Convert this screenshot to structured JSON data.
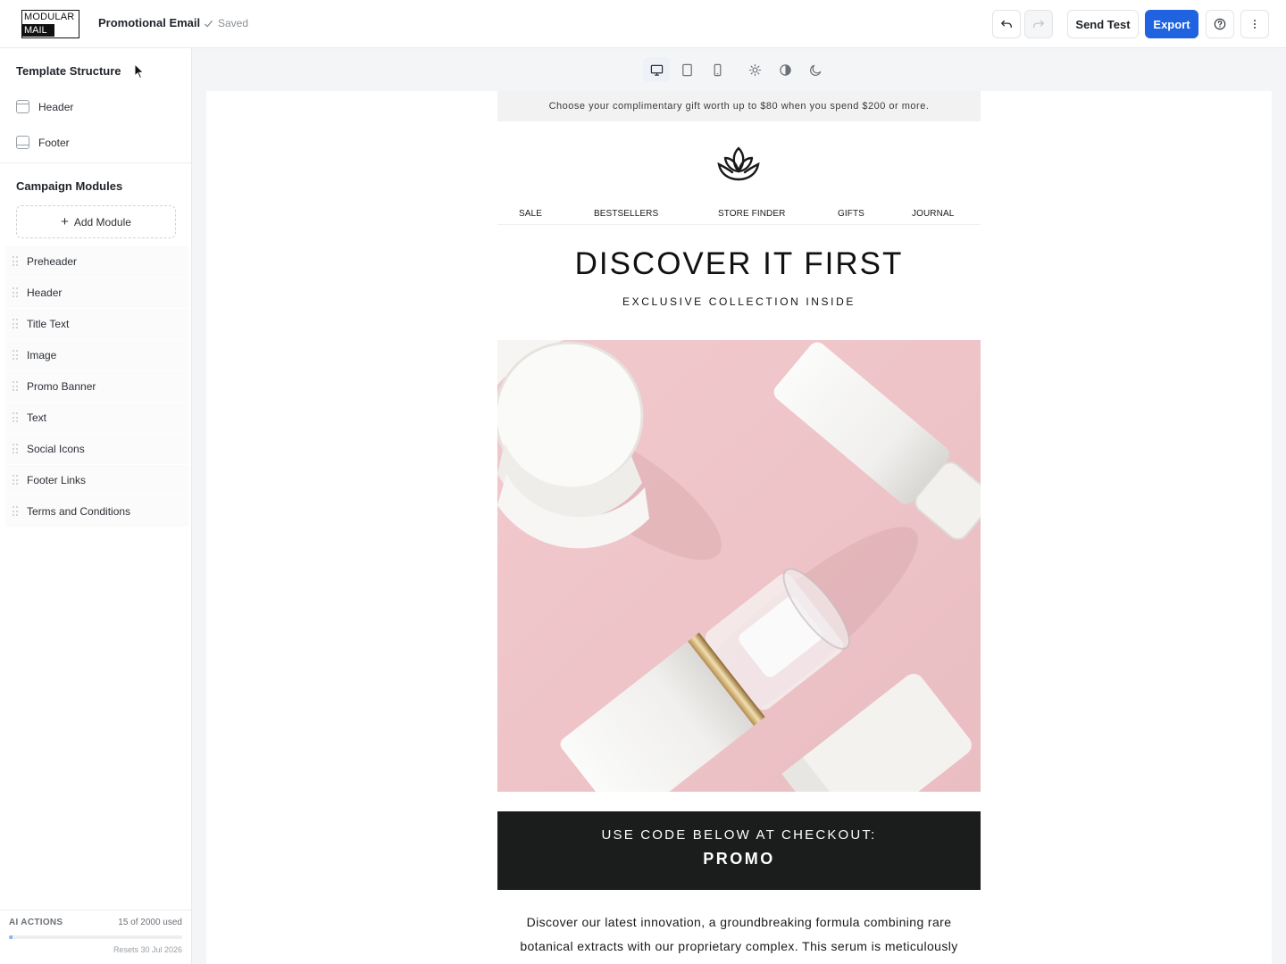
{
  "app": {
    "logo_top": "MODULAR",
    "logo_bottom": "MAIL",
    "document_title": "Promotional Email",
    "save_status": "Saved"
  },
  "toolbar": {
    "undo_icon": "undo-icon",
    "redo_icon": "redo-icon",
    "send_test_label": "Send Test",
    "export_label": "Export",
    "help_icon": "help-circle-icon",
    "more_icon": "more-vertical-icon",
    "accent_color": "#1f63e0"
  },
  "sidebar": {
    "template_structure_title": "Template Structure",
    "structure_items": [
      {
        "label": "Header",
        "icon": "header-layout-icon"
      },
      {
        "label": "Footer",
        "icon": "footer-layout-icon"
      }
    ],
    "campaign_modules_title": "Campaign Modules",
    "add_module_label": "Add Module",
    "modules": [
      {
        "label": "Preheader"
      },
      {
        "label": "Header"
      },
      {
        "label": "Title Text"
      },
      {
        "label": "Image"
      },
      {
        "label": "Promo Banner"
      },
      {
        "label": "Text"
      },
      {
        "label": "Social Icons"
      },
      {
        "label": "Footer Links"
      },
      {
        "label": "Terms and Conditions"
      }
    ],
    "ai": {
      "label": "AI ACTIONS",
      "usage": "15 of 2000 used",
      "used": 15,
      "total": 2000,
      "reset": "Resets 30 Jul 2026"
    }
  },
  "preview_toolbar": {
    "devices": [
      "desktop-icon",
      "tablet-icon",
      "mobile-icon"
    ],
    "active_device": "desktop-icon",
    "themes": [
      "light-mode-icon",
      "contrast-icon",
      "dark-mode-icon"
    ]
  },
  "email": {
    "preheader": "Choose your complimentary gift worth up to $80 when you spend $200 or more.",
    "brand_icon": "lotus-logo-icon",
    "nav": [
      "SALE",
      "BESTSELLERS",
      "STORE FINDER",
      "GIFTS",
      "JOURNAL"
    ],
    "title": "DISCOVER IT FIRST",
    "subtitle": "EXCLUSIVE COLLECTION INSIDE",
    "hero_image": "pink-cosmetics-product-photo",
    "promo_line": "USE CODE BELOW AT CHECKOUT:",
    "promo_code": "PROMO",
    "body_line_1": "Discover our latest innovation, a groundbreaking formula combining rare",
    "body_line_2": "botanical extracts with our proprietary complex. This serum is meticulously"
  }
}
